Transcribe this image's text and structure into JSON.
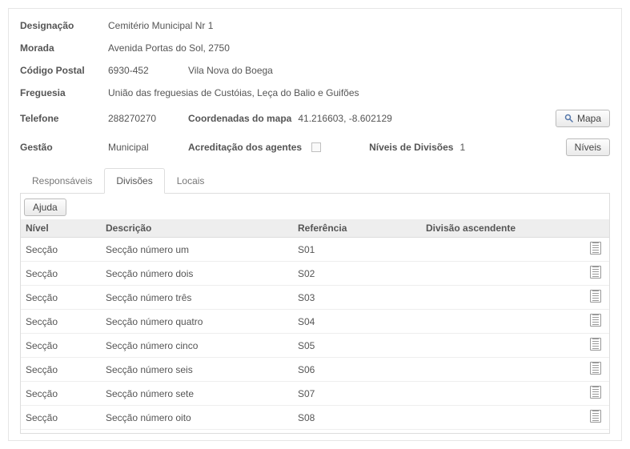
{
  "fields": {
    "designacao_label": "Designação",
    "designacao_value": "Cemitério Municipal Nr 1",
    "morada_label": "Morada",
    "morada_value": "Avenida Portas do Sol, 2750",
    "codigo_postal_label": "Código Postal",
    "codigo_postal_value": "6930-452",
    "localidade_value": "Vila Nova do Boega",
    "freguesia_label": "Freguesia",
    "freguesia_value": "União das freguesias de Custóias, Leça do Balio e Guifões",
    "telefone_label": "Telefone",
    "telefone_value": "288270270",
    "coordenadas_label": "Coordenadas do mapa",
    "coordenadas_value": "41.216603, -8.602129",
    "mapa_button": "Mapa",
    "gestao_label": "Gestão",
    "gestao_value": "Municipal",
    "acreditacao_label": "Acreditação dos agentes",
    "niveis_divisoes_label": "Níveis de Divisões",
    "niveis_divisoes_value": "1",
    "niveis_button": "Níveis"
  },
  "tabs": {
    "responsaveis": "Responsáveis",
    "divisoes": "Divisões",
    "locais": "Locais"
  },
  "help_button": "Ajuda",
  "table": {
    "headers": {
      "nivel": "Nível",
      "descricao": "Descrição",
      "referencia": "Referência",
      "divisao_ascendente": "Divisão ascendente"
    },
    "rows": [
      {
        "nivel": "Secção",
        "descricao": "Secção número um",
        "referencia": "S01",
        "ascendente": ""
      },
      {
        "nivel": "Secção",
        "descricao": "Secção número dois",
        "referencia": "S02",
        "ascendente": ""
      },
      {
        "nivel": "Secção",
        "descricao": "Secção número três",
        "referencia": "S03",
        "ascendente": ""
      },
      {
        "nivel": "Secção",
        "descricao": "Secção número quatro",
        "referencia": "S04",
        "ascendente": ""
      },
      {
        "nivel": "Secção",
        "descricao": "Secção número cinco",
        "referencia": "S05",
        "ascendente": ""
      },
      {
        "nivel": "Secção",
        "descricao": "Secção número seis",
        "referencia": "S06",
        "ascendente": ""
      },
      {
        "nivel": "Secção",
        "descricao": "Secção número sete",
        "referencia": "S07",
        "ascendente": ""
      },
      {
        "nivel": "Secção",
        "descricao": "Secção número oito",
        "referencia": "S08",
        "ascendente": ""
      }
    ]
  }
}
